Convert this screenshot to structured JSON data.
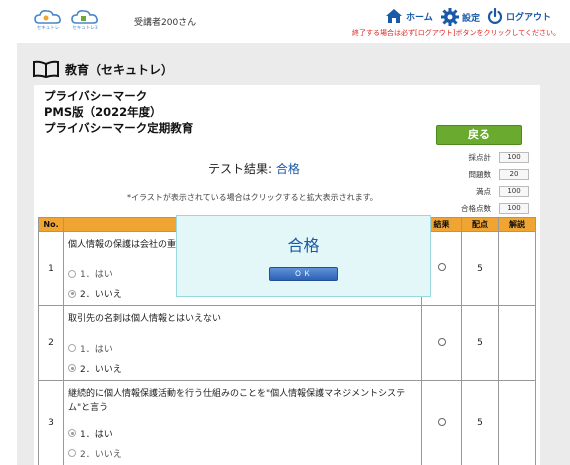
{
  "header": {
    "logo1_text": "セキュトレ",
    "logo2_text": "セキュトレ3",
    "user": "受講者200さん",
    "nav": {
      "home": "ホーム",
      "settings": "設定",
      "logout": "ログアウト"
    },
    "logout_note": "終了する場合は必ず[ログアウト]ボタンをクリックしてください。"
  },
  "section": {
    "title": "教育（セキュトレ）"
  },
  "course": {
    "line1": "プライバシーマーク",
    "line2": "PMS版（2022年度）",
    "line3": "プライバシーマーク定期教育"
  },
  "back_button": "戻る",
  "result": {
    "label": "テスト結果:",
    "value": "合格"
  },
  "note": "*イラストが表示されている場合はクリックすると拡大表示されます。",
  "stats": [
    {
      "label": "採点計",
      "value": "100"
    },
    {
      "label": "問題数",
      "value": "20"
    },
    {
      "label": "満点",
      "value": "100"
    },
    {
      "label": "合格点数",
      "value": "100"
    }
  ],
  "table": {
    "headers": {
      "no": "No.",
      "question": "",
      "result": "結果",
      "points": "配点",
      "explain": "解説"
    },
    "rows": [
      {
        "no": "1",
        "question": "個人情報の保護は会社の重",
        "options": [
          {
            "label": "1．はい",
            "selected": false
          },
          {
            "label": "2．いいえ",
            "selected": true
          }
        ],
        "points": "5"
      },
      {
        "no": "2",
        "question": "取引先の名刺は個人情報とはいえない",
        "options": [
          {
            "label": "1．はい",
            "selected": false
          },
          {
            "label": "2．いいえ",
            "selected": true
          }
        ],
        "points": "5"
      },
      {
        "no": "3",
        "question": "継続的に個人情報保護活動を行う仕組みのことを\"個人情報保護マネジメントシステム\"と言う",
        "options": [
          {
            "label": "1．はい",
            "selected": true
          },
          {
            "label": "2．いいえ",
            "selected": false
          }
        ],
        "points": "5"
      }
    ]
  },
  "modal": {
    "title": "合格",
    "ok": "ＯＫ"
  }
}
